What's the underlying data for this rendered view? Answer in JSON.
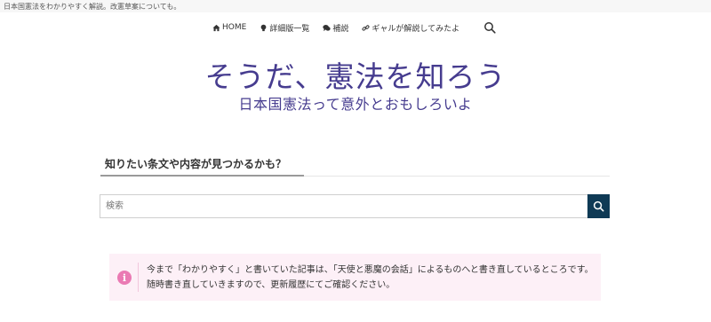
{
  "tagline": "日本国憲法をわかりやすく解説。改憲草案についても。",
  "nav": {
    "items": [
      {
        "label": "HOME",
        "icon": "home-icon"
      },
      {
        "label": "詳細版一覧",
        "icon": "lightbulb-icon"
      },
      {
        "label": "補説",
        "icon": "speech-bubble-icon"
      },
      {
        "label": "ギャルが解説してみたよ",
        "icon": "link-icon"
      }
    ],
    "search_icon": "search-icon"
  },
  "site": {
    "title": "そうだ、憲法を知ろう",
    "subtitle": "日本国憲法って意外とおもしろいよ"
  },
  "search_section": {
    "heading": "知りたい条文や内容が見つかるかも？",
    "placeholder": "検索",
    "button_icon": "search-icon"
  },
  "notice": {
    "icon": "info-icon",
    "icon_glyph": "i",
    "text": "今まで「わかりやすく」と書いていた記事は、「天使と悪魔の会話」によるものへと書き直しているところです。随時書き直していきますので、更新履歴にてご確認ください。"
  },
  "colors": {
    "title": "#463c8f",
    "search_button": "#0f3a55",
    "notice_background": "#fdf0f7",
    "notice_icon": "#ea7ab3"
  }
}
